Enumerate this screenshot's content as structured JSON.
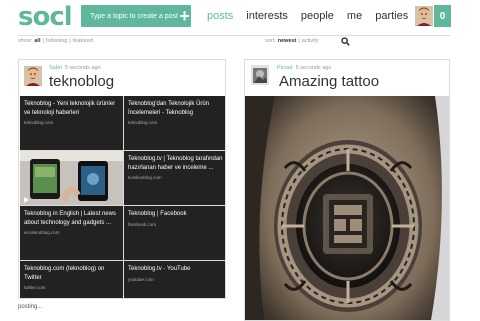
{
  "header": {
    "logo": "socl",
    "post_button_label": "Type a topic to create a post",
    "nav": [
      "posts",
      "interests",
      "people",
      "me",
      "parties"
    ],
    "active_nav": "posts",
    "notification_count": "0"
  },
  "left_filters": {
    "prefix": "show:",
    "items": [
      "all",
      "following",
      "featured"
    ],
    "active": "all",
    "separator": "|"
  },
  "right_filters": {
    "prefix": "sort:",
    "items": [
      "newest",
      "activity"
    ],
    "active": "newest",
    "separator": "|"
  },
  "posts": [
    {
      "author": "Sabri",
      "time": "5 seconds ago",
      "title": "teknoblog",
      "tiles": [
        {
          "title": "Teknoblog - Yeni teknolojik ürünler ve teknoloji haberleri",
          "domain": "teknoblog.com"
        },
        {
          "title": "Teknoblog'dan Teknolojik Ürün İncelemeleri - Teknoblog",
          "domain": "teknoblog.com"
        },
        {
          "title": "",
          "domain": ""
        },
        {
          "title": "Teknoblog.tv | Teknoblog tarafından hazırlanan haber ve inceleme ...",
          "domain": "tv.teknoblog.com"
        },
        {
          "title": "Teknoblog in English | Latest news about technology and gadgets ...",
          "domain": "en.teknoblog.com"
        },
        {
          "title": "Teknoblog | Facebook",
          "domain": "facebook.com"
        },
        {
          "title": "Teknoblog.com (teknoblog) on Twitter",
          "domain": "twitter.com"
        },
        {
          "title": "Teknoblog.tv - YouTube",
          "domain": "youtube.com"
        }
      ]
    },
    {
      "author": "Picrad",
      "time": "5 seconds ago",
      "title": "Amazing tattoo"
    }
  ],
  "status": "posting..."
}
